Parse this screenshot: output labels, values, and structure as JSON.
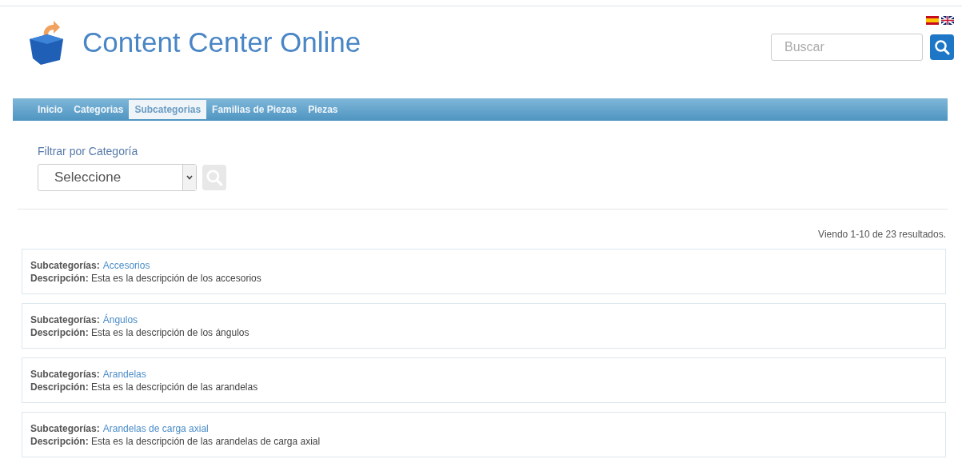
{
  "header": {
    "title": "Content Center Online",
    "search": {
      "placeholder": "Buscar"
    }
  },
  "nav": [
    {
      "label": "Inicio",
      "selected": false
    },
    {
      "label": "Categorias",
      "selected": false
    },
    {
      "label": "Subcategorias",
      "selected": true
    },
    {
      "label": "Familias de Piezas",
      "selected": false
    },
    {
      "label": "Piezas",
      "selected": false
    }
  ],
  "filter": {
    "label": "Filtrar por Categoría",
    "select_value": "Seleccione"
  },
  "results_count": "Viendo 1-10 de 23 resultados.",
  "results": [
    {
      "label": "Subcategorías:",
      "name": "Accesorios",
      "description": "**Descripción:** Esta es la descripción de los accesorios"
    },
    {
      "label": "Subcategorías:",
      "name": "Ángulos",
      "description": "**Descripción:** Esta es la descripción de los ángulos"
    },
    {
      "label": "Subcategorías:",
      "name": "Arandelas",
      "description": "**Descripción:** Esta es la descripción de las arandelas"
    },
    {
      "label": "Subcategorías:",
      "name": "Arandelas de carga axial",
      "description": "**Descripción:** Esta es la descripción de las arandelas de carga axial"
    }
  ]
}
